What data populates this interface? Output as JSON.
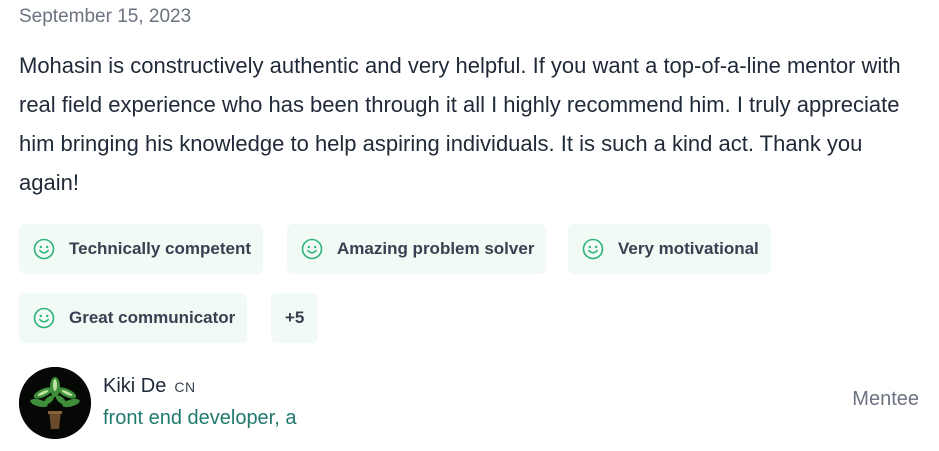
{
  "review": {
    "date": "September 15, 2023",
    "text": "Mohasin is constructively authentic and very helpful. If you want a top-of-a-line mentor with real field experience who has been through it all I highly recommend him. I truly appreciate him bringing his knowledge to help aspiring individuals. It is such a kind act. Thank you again!",
    "tags": [
      {
        "label": "Technically competent",
        "icon": "smiley-icon"
      },
      {
        "label": "Amazing problem solver",
        "icon": "smiley-icon"
      },
      {
        "label": "Very motivational",
        "icon": "smiley-icon"
      },
      {
        "label": "Great communicator",
        "icon": "smiley-icon"
      }
    ],
    "more_tags": "+5"
  },
  "reviewer": {
    "name": "Kiki De",
    "country": "CN",
    "role": "front end developer, a",
    "badge": "Mentee"
  },
  "colors": {
    "tag_background": "#f1faf5",
    "smiley_green": "#2fb37a",
    "role_teal": "#1f7a6c",
    "muted_gray": "#6b7280"
  }
}
